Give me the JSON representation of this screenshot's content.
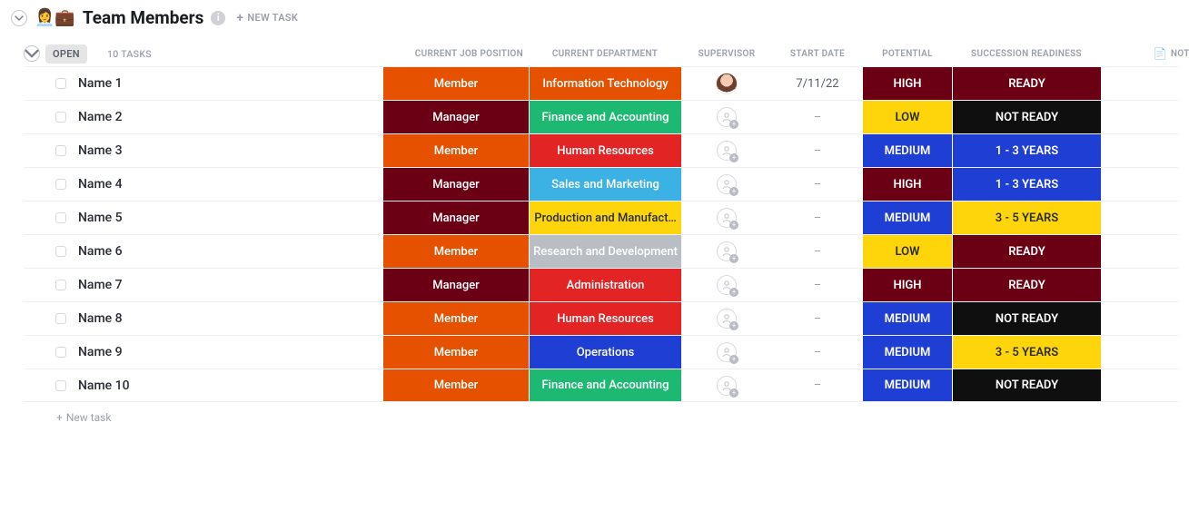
{
  "header": {
    "emojis": "👩‍💼💼",
    "title": "Team Members",
    "newTaskTop": "NEW TASK"
  },
  "group": {
    "status": "OPEN",
    "count": "10 TASKS",
    "newTaskRow": "New task"
  },
  "columns": {
    "position": "CURRENT JOB POSITION",
    "department": "CURRENT DEPARTMENT",
    "supervisor": "SUPERVISOR",
    "startDate": "START DATE",
    "potential": "POTENTIAL",
    "readiness": "SUCCESSION READINESS",
    "notes": "NOTES"
  },
  "tasks": [
    {
      "name": "Name 1",
      "position": {
        "label": "Member",
        "color": "orange"
      },
      "department": {
        "label": "Information Technology",
        "color": "orange"
      },
      "supervisor": "avatar",
      "startDate": "7/11/22",
      "potential": {
        "label": "HIGH",
        "color": "darkred"
      },
      "readiness": {
        "label": "READY",
        "color": "darkred"
      }
    },
    {
      "name": "Name 2",
      "position": {
        "label": "Manager",
        "color": "darkred"
      },
      "department": {
        "label": "Finance and Accounting",
        "color": "green"
      },
      "supervisor": "placeholder",
      "startDate": "–",
      "potential": {
        "label": "LOW",
        "color": "yellow"
      },
      "readiness": {
        "label": "NOT READY",
        "color": "black"
      }
    },
    {
      "name": "Name 3",
      "position": {
        "label": "Member",
        "color": "orange"
      },
      "department": {
        "label": "Human Resources",
        "color": "red"
      },
      "supervisor": "placeholder",
      "startDate": "–",
      "potential": {
        "label": "MEDIUM",
        "color": "blue"
      },
      "readiness": {
        "label": "1 - 3 YEARS",
        "color": "blue"
      }
    },
    {
      "name": "Name 4",
      "position": {
        "label": "Manager",
        "color": "darkred"
      },
      "department": {
        "label": "Sales and Marketing",
        "color": "skyblue"
      },
      "supervisor": "placeholder",
      "startDate": "–",
      "potential": {
        "label": "HIGH",
        "color": "darkred"
      },
      "readiness": {
        "label": "1 - 3 YEARS",
        "color": "blue"
      }
    },
    {
      "name": "Name 5",
      "position": {
        "label": "Manager",
        "color": "darkred"
      },
      "department": {
        "label": "Production and Manufact…",
        "color": "yellow"
      },
      "supervisor": "placeholder",
      "startDate": "–",
      "potential": {
        "label": "MEDIUM",
        "color": "blue"
      },
      "readiness": {
        "label": "3 - 5 YEARS",
        "color": "yellow"
      }
    },
    {
      "name": "Name 6",
      "position": {
        "label": "Member",
        "color": "orange"
      },
      "department": {
        "label": "Research and Development",
        "color": "grey"
      },
      "supervisor": "placeholder",
      "startDate": "–",
      "potential": {
        "label": "LOW",
        "color": "yellow"
      },
      "readiness": {
        "label": "READY",
        "color": "darkred"
      }
    },
    {
      "name": "Name 7",
      "position": {
        "label": "Manager",
        "color": "darkred"
      },
      "department": {
        "label": "Administration",
        "color": "red"
      },
      "supervisor": "placeholder",
      "startDate": "–",
      "potential": {
        "label": "HIGH",
        "color": "darkred"
      },
      "readiness": {
        "label": "READY",
        "color": "darkred"
      }
    },
    {
      "name": "Name 8",
      "position": {
        "label": "Member",
        "color": "orange"
      },
      "department": {
        "label": "Human Resources",
        "color": "red"
      },
      "supervisor": "placeholder",
      "startDate": "–",
      "potential": {
        "label": "MEDIUM",
        "color": "blue"
      },
      "readiness": {
        "label": "NOT READY",
        "color": "black"
      }
    },
    {
      "name": "Name 9",
      "position": {
        "label": "Member",
        "color": "orange"
      },
      "department": {
        "label": "Operations",
        "color": "blue"
      },
      "supervisor": "placeholder",
      "startDate": "–",
      "potential": {
        "label": "MEDIUM",
        "color": "blue"
      },
      "readiness": {
        "label": "3 - 5 YEARS",
        "color": "yellow"
      }
    },
    {
      "name": "Name 10",
      "position": {
        "label": "Member",
        "color": "orange"
      },
      "department": {
        "label": "Finance and Accounting",
        "color": "green"
      },
      "supervisor": "placeholder",
      "startDate": "–",
      "potential": {
        "label": "MEDIUM",
        "color": "blue"
      },
      "readiness": {
        "label": "NOT READY",
        "color": "black"
      }
    }
  ]
}
